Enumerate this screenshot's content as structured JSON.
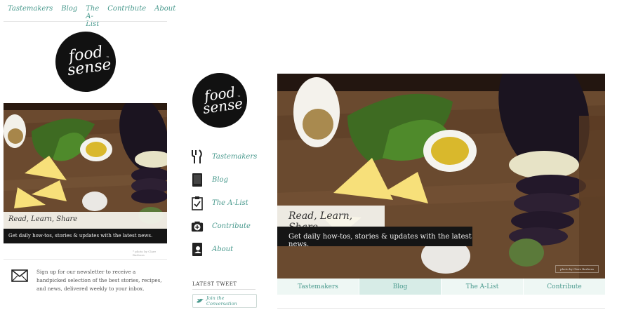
{
  "mobile": {
    "nav": [
      "Tastemakers",
      "Blog",
      "The A-List",
      "Contribute",
      "About"
    ],
    "hero": {
      "caption_title": "Read, Learn, Share",
      "caption_text": "Get daily how-tos, stories & updates with the latest news."
    },
    "photo_credit": "* photo by Clare Barboza",
    "newsletter": "Sign up for our newsletter to receive a handpicked selection of the best stories, recipes, and news, delivered weekly to your inbox."
  },
  "brand": {
    "line1": "food",
    "line2": "sense",
    "tm": "™"
  },
  "sidebar": {
    "items": [
      {
        "label": "Tastemakers",
        "icon": "utensils-icon"
      },
      {
        "label": "Blog",
        "icon": "notebook-icon"
      },
      {
        "label": "The A-List",
        "icon": "clipboard-check-icon"
      },
      {
        "label": "Contribute",
        "icon": "camera-add-icon"
      },
      {
        "label": "About",
        "icon": "profile-book-icon"
      }
    ],
    "latest_tweet_title": "LATEST TWEET",
    "tweet_button": "Join the Conversation"
  },
  "desktop": {
    "hero": {
      "caption_title": "Read, Learn, Share",
      "caption_text": "Get daily how-tos, stories & updates with the latest news.",
      "photo_tag": "photo by Clare Barboza"
    },
    "tabs": [
      "Tastemakers",
      "Blog",
      "The A-List",
      "Contribute"
    ],
    "active_tab": "Blog"
  },
  "colors": {
    "accent": "#4a9a8e",
    "tab_bg": "#eef7f4",
    "tab_active": "#d7ece7"
  }
}
